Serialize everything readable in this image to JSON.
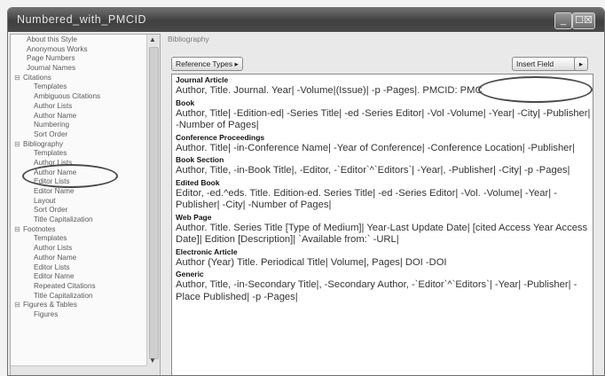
{
  "window": {
    "title": "Numbered_with_PMCID",
    "min_symbol": "_",
    "close_symbol": "☐☒"
  },
  "sidebar": {
    "items": [
      {
        "label": "About this Style",
        "level": 0
      },
      {
        "label": "Anonymous Works",
        "level": 0
      },
      {
        "label": "Page Numbers",
        "level": 0
      },
      {
        "label": "Journal Names",
        "level": 0
      },
      {
        "label": "Citations",
        "level": 0,
        "group": true,
        "expander": "⊟"
      },
      {
        "label": "Templates",
        "level": 1
      },
      {
        "label": "Ambiguous Citations",
        "level": 1
      },
      {
        "label": "Author Lists",
        "level": 1
      },
      {
        "label": "Author Name",
        "level": 1
      },
      {
        "label": "Numbering",
        "level": 1
      },
      {
        "label": "Sort Order",
        "level": 1
      },
      {
        "label": "Bibliography",
        "level": 0,
        "group": true,
        "expander": "⊟"
      },
      {
        "label": "Templates",
        "level": 1,
        "selected": true
      },
      {
        "label": "Author Lists",
        "level": 1
      },
      {
        "label": "Author Name",
        "level": 1
      },
      {
        "label": "Editor Lists",
        "level": 1
      },
      {
        "label": "Editor Name",
        "level": 1
      },
      {
        "label": "Layout",
        "level": 1
      },
      {
        "label": "Sort Order",
        "level": 1
      },
      {
        "label": "Title Capitalization",
        "level": 1
      },
      {
        "label": "Footnotes",
        "level": 0,
        "group": true,
        "expander": "⊟"
      },
      {
        "label": "Templates",
        "level": 1
      },
      {
        "label": "Author Lists",
        "level": 1
      },
      {
        "label": "Author Name",
        "level": 1
      },
      {
        "label": "Editor Lists",
        "level": 1
      },
      {
        "label": "Editor Name",
        "level": 1
      },
      {
        "label": "Repeated Citations",
        "level": 1
      },
      {
        "label": "Title Capitalization",
        "level": 1
      },
      {
        "label": "Figures & Tables",
        "level": 0,
        "group": true,
        "expander": "⊟"
      },
      {
        "label": "Figures",
        "level": 1
      }
    ]
  },
  "main": {
    "header": "Bibliography",
    "reference_types_button": "Reference Types ▸",
    "insert_field_button": "Insert Field",
    "insert_field_arrow": "▸",
    "sections": [
      {
        "title": "Journal Article",
        "body": "Author, Title. Journal. Year| -Volume|(Issue)| -p -Pages|. PMCID: PMC"
      },
      {
        "title": "Book",
        "body": "Author, Title| -Edition-ed| -Series Title| -ed -Series Editor| -Vol -Volume| -Year| -City| -Publisher| -Number of Pages|"
      },
      {
        "title": "Conference Proceedings",
        "body": "Author. Title| -in-Conference Name| -Year of Conference| -Conference Location| -Publisher|"
      },
      {
        "title": "Book Section",
        "body": "Author, Title, -in-Book Title|, -Editor, -`Editor`^`Editors`| -Year|, -Publisher| -City| -p -Pages|"
      },
      {
        "title": "Edited Book",
        "body": "Editor, -ed.^eds. Title. Edition-ed. Series Title| -ed -Series Editor| -Vol. -Volume| -Year| -Publisher| -City| -Number of Pages|"
      },
      {
        "title": "Web Page",
        "body": "Author. Title. Series Title [Type of Medium]| Year-Last Update Date| [cited Access Year Access Date]| Edition [Description]| `Available from:` -URL|"
      },
      {
        "title": "Electronic Article",
        "body": "Author (Year) Title. Periodical Title| Volume|, Pages| DOI -DOI"
      },
      {
        "title": "Generic",
        "body": "Author, Title, -in-Secondary Title|, -Secondary Author, -`Editor`^`Editors`| -Year| -Publisher| -Place Published| -p -Pages|"
      }
    ]
  }
}
